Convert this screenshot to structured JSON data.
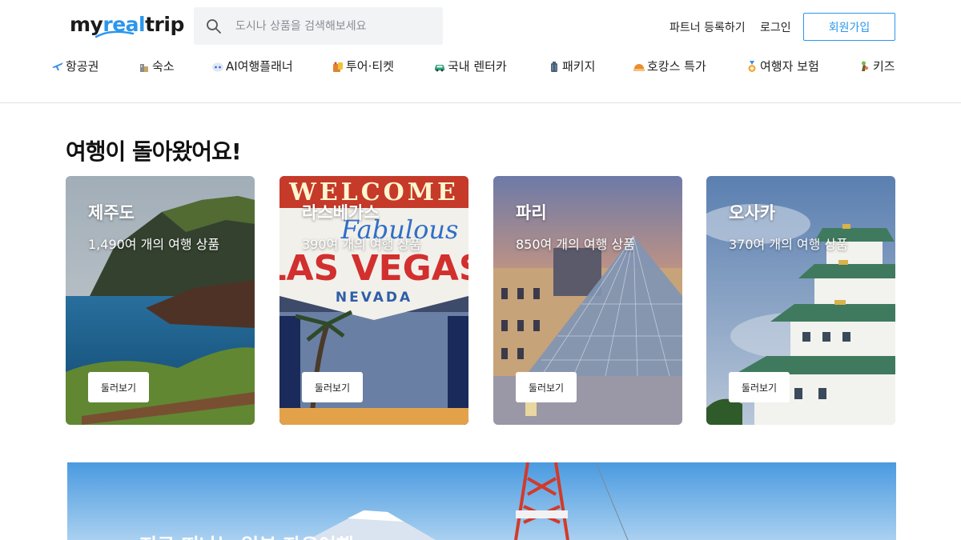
{
  "header": {
    "logo": {
      "prefix": "my",
      "accent": "real",
      "suffix": "trip"
    },
    "search": {
      "placeholder": "도시나 상품을 검색해보세요",
      "icon": "search-icon"
    },
    "links": {
      "partner": "파트너 등록하기",
      "login": "로그인",
      "signup": "회원가입"
    },
    "accent_color": "#2b96ed"
  },
  "nav": {
    "items": [
      {
        "label": "항공권",
        "icon": "airplane-icon"
      },
      {
        "label": "숙소",
        "icon": "building-icon"
      },
      {
        "label": "AI여행플래너",
        "icon": "ai-robot-icon"
      },
      {
        "label": "투어·티켓",
        "icon": "ticket-bag-icon"
      },
      {
        "label": "국내 렌터카",
        "icon": "car-icon"
      },
      {
        "label": "패키지",
        "icon": "suitcase-icon"
      },
      {
        "label": "호캉스 특가",
        "icon": "sunset-icon"
      },
      {
        "label": "여행자 보험",
        "icon": "insurance-medal-icon"
      },
      {
        "label": "키즈",
        "icon": "kids-icon"
      }
    ]
  },
  "main": {
    "section_title": "여행이 돌아왔어요!",
    "cards": [
      {
        "city": "제주도",
        "count": "1,490여 개의 여행 상품",
        "button": "둘러보기"
      },
      {
        "city": "라스베가스",
        "count": "390여 개의 여행 상품",
        "button": "둘러보기",
        "sign_top": "WELCOME",
        "sign_mid": "Fabulous",
        "sign_main": "LAS VEGAS",
        "sign_sub": "NEVADA"
      },
      {
        "city": "파리",
        "count": "850여 개의 여행 상품",
        "button": "둘러보기"
      },
      {
        "city": "오사카",
        "count": "370여 개의 여행 상품",
        "button": "둘러보기"
      }
    ],
    "banner": {
      "title": "지금 떠나는 일본 자유여행"
    }
  }
}
